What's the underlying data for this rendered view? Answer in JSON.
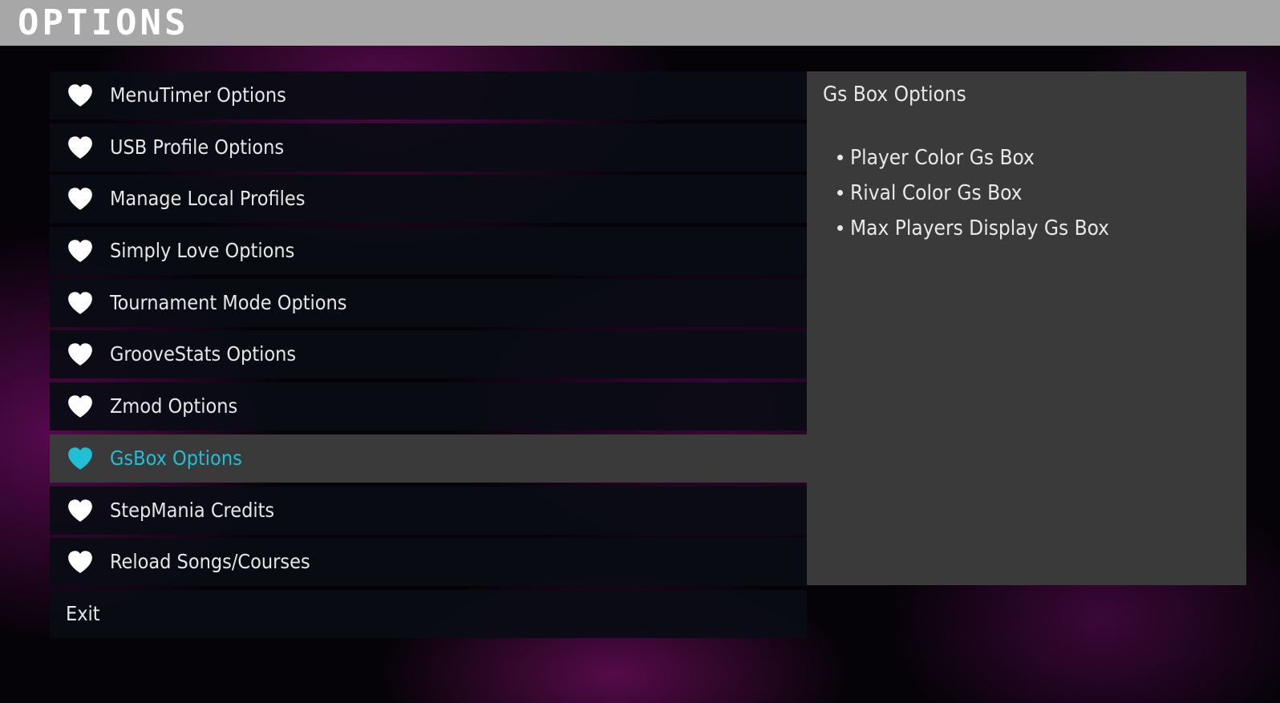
{
  "screen": {
    "title": "OPTIONS"
  },
  "menu": {
    "items": [
      {
        "label": "MenuTimer Options",
        "icon": "heart-icon",
        "selected": false
      },
      {
        "label": "USB Profile Options",
        "icon": "heart-icon",
        "selected": false
      },
      {
        "label": "Manage Local Profiles",
        "icon": "heart-icon",
        "selected": false
      },
      {
        "label": "Simply Love Options",
        "icon": "heart-icon",
        "selected": false
      },
      {
        "label": "Tournament Mode Options",
        "icon": "heart-icon",
        "selected": false
      },
      {
        "label": "GrooveStats Options",
        "icon": "heart-icon",
        "selected": false
      },
      {
        "label": "Zmod Options",
        "icon": "heart-icon",
        "selected": false
      },
      {
        "label": "GsBox Options",
        "icon": "heart-icon",
        "selected": true
      },
      {
        "label": "StepMania Credits",
        "icon": "heart-icon",
        "selected": false
      },
      {
        "label": "Reload Songs/Courses",
        "icon": "heart-icon",
        "selected": false
      }
    ],
    "exit_label": "Exit"
  },
  "panel": {
    "title": "Gs Box Options",
    "items": [
      "Player Color Gs Box",
      "Rival Color Gs Box",
      "Max Players Display Gs Box"
    ]
  },
  "colors": {
    "header_bg": "#a7a7a7",
    "row_bg": "#0a0c14",
    "selected_bg": "#3a3a3a",
    "accent": "#1fbfd6",
    "text": "#e6e6e6",
    "background_glow": "#690c5a"
  }
}
